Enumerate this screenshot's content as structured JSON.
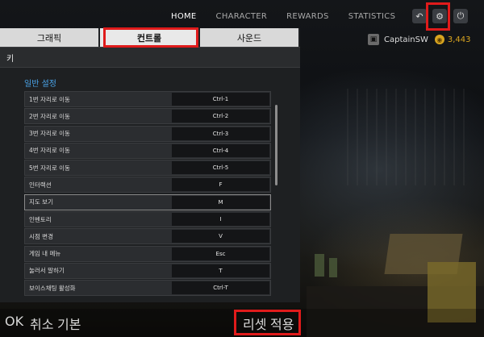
{
  "topnav": {
    "items": [
      "HOME",
      "CHARACTER",
      "REWARDS",
      "STATISTICS"
    ],
    "active": "HOME"
  },
  "icons": {
    "left": "↶",
    "gear": "⚙",
    "power": "⏻"
  },
  "user": {
    "name": "CaptainSW",
    "coins": "3,443"
  },
  "settings": {
    "tabs": [
      "그래픽",
      "컨트롤",
      "사운드"
    ],
    "active_tab": "컨트롤",
    "header": "키",
    "section": "일반 설정",
    "bindings": [
      {
        "label": "1번 자리로 이동",
        "key": "Ctrl-1"
      },
      {
        "label": "2번 자리로 이동",
        "key": "Ctrl-2"
      },
      {
        "label": "3번 자리로 이동",
        "key": "Ctrl-3"
      },
      {
        "label": "4번 자리로 이동",
        "key": "Ctrl-4"
      },
      {
        "label": "5번 자리로 이동",
        "key": "Ctrl-5"
      },
      {
        "label": "인터랙션",
        "key": "F"
      },
      {
        "label": "지도 보기",
        "key": "M"
      },
      {
        "label": "인벤토리",
        "key": "I"
      },
      {
        "label": "시점 변경",
        "key": "V"
      },
      {
        "label": "게임 내 메뉴",
        "key": "Esc"
      },
      {
        "label": "눌러서 말하기",
        "key": "T"
      },
      {
        "label": "보이스채팅 활성화",
        "key": "Ctrl-T"
      }
    ]
  },
  "footer": {
    "ok": "OK",
    "cancel": "취소",
    "default": "기본",
    "reset": "리셋",
    "apply": "적용"
  }
}
